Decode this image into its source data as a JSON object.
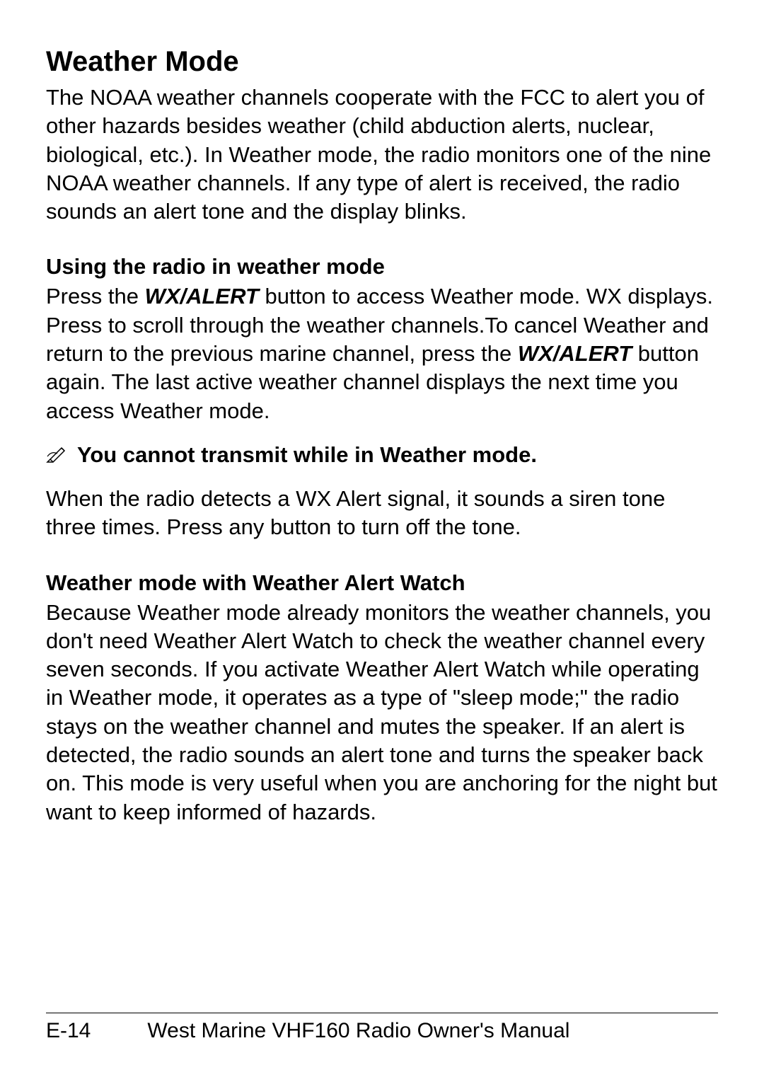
{
  "heading1": "Weather Mode",
  "intro": "The NOAA weather channels cooperate with the FCC to alert you of other hazards besides weather (child abduction alerts, nuclear, biological, etc.). In Weather mode, the radio monitors one of the nine NOAA weather channels. If any type of alert is received, the radio sounds an alert tone and the display blinks.",
  "section1": {
    "heading": "Using the radio in weather mode",
    "text1_part1": "Press the ",
    "text1_bold1": "WX/ALERT",
    "text1_part2": " button to access Weather mode. WX displays. Press  to scroll through the weather channels.To cancel Weather and return to the previous marine channel, press the ",
    "text1_bold2": "WX/ALERT",
    "text1_part3": " button again. The last active weather channel  displays the next time you access Weather mode."
  },
  "note": {
    "icon": "✎",
    "text": "You cannot transmit while in Weather mode."
  },
  "after_note": "When the radio detects a WX Alert signal, it sounds a siren tone three times. Press any button to turn off the tone.",
  "section2": {
    "heading": "Weather mode with Weather Alert Watch",
    "text": "Because Weather mode already monitors the weather channels, you don't need Weather Alert Watch to check the weather channel every seven seconds. If you activate Weather Alert Watch while operating in Weather mode, it operates as a type of \"sleep mode;\" the radio stays on the weather channel and mutes the speaker. If an alert is detected, the radio sounds an alert tone and turns the speaker back on. This mode is very useful when you are anchoring for the night but want to keep informed of hazards."
  },
  "footer": {
    "page_number": "E-14",
    "title": "West Marine VHF160 Radio Owner's Manual"
  }
}
